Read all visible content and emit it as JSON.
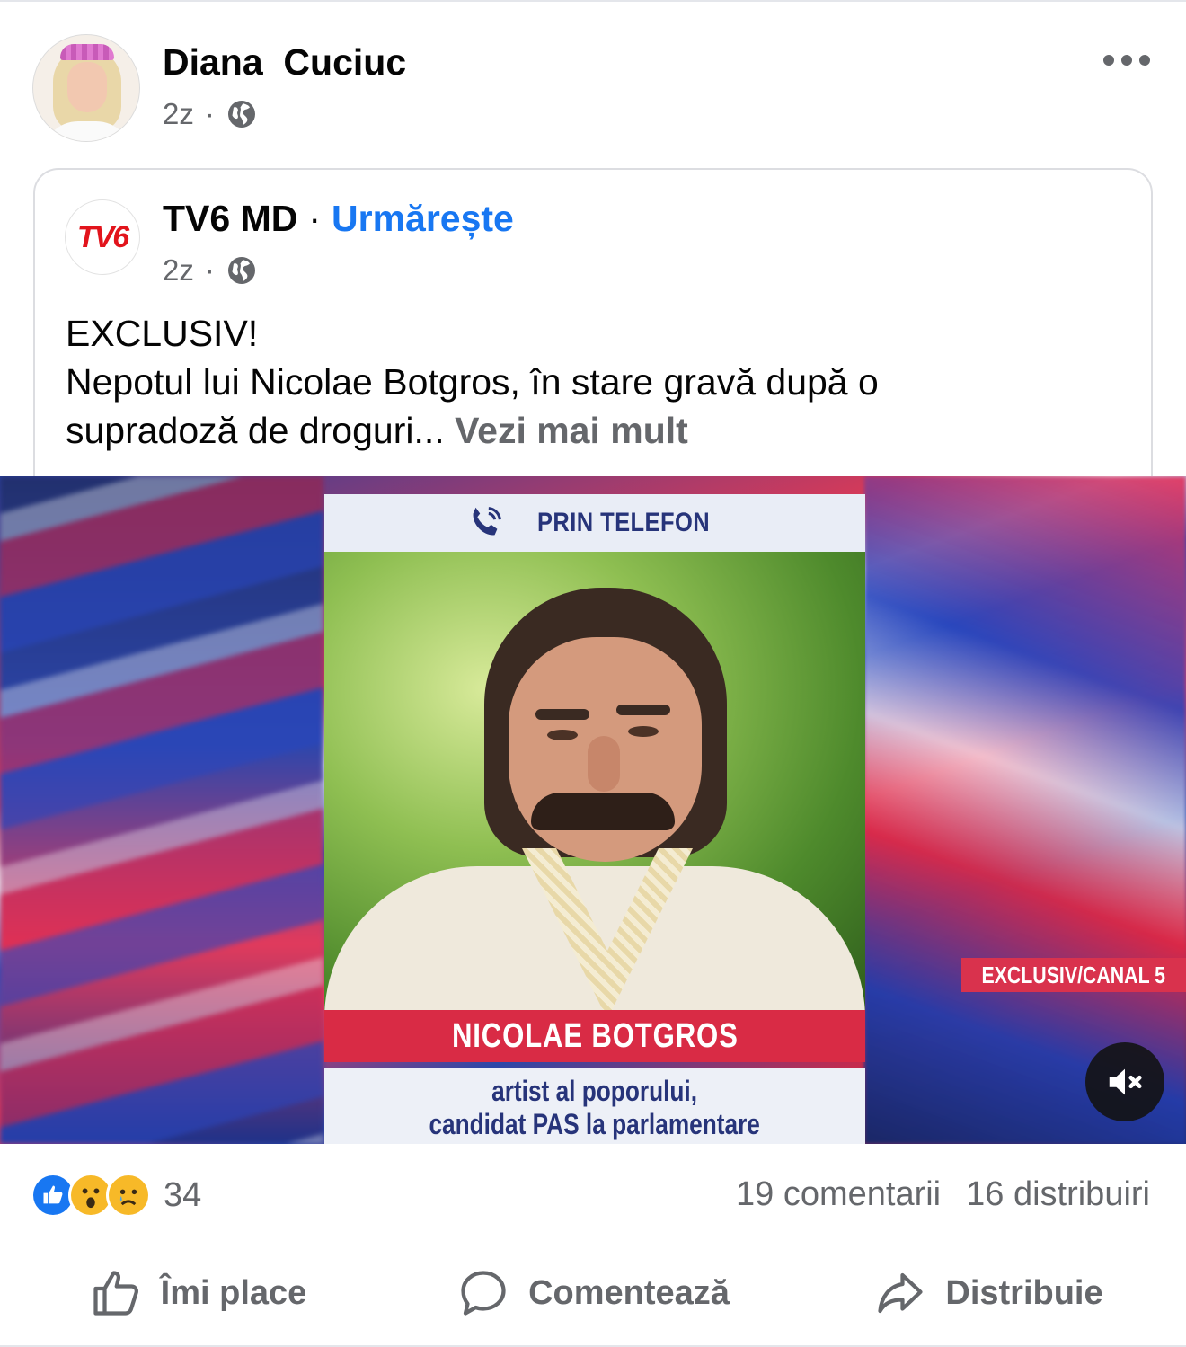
{
  "post": {
    "author": "Diana  Cuciuc",
    "time": "2z",
    "separator": "·",
    "privacy_icon": "globe-icon",
    "more_icon": "more-options-icon"
  },
  "shared": {
    "page_name": "TV6 MD",
    "separator": "·",
    "follow_label": "Urmărește",
    "time": "2z",
    "logo_text": "TV6",
    "text_line1": "EXCLUSIV!",
    "text_line2": "Nepotul lui Nicolae Botgros, în stare gravă după o",
    "text_line3": "supradoză de droguri...",
    "see_more": "Vezi mai mult"
  },
  "media": {
    "phone_label": "PRIN TELEFON",
    "name_caption": "NICOLAE BOTGROS",
    "desc_line1": "artist al poporului,",
    "desc_line2": "candidat PAS la parlamentare",
    "tag": "EXCLUSIV/CANAL 5",
    "mute_icon": "speaker-muted-icon"
  },
  "stats": {
    "reactions": [
      "like",
      "wow",
      "sad"
    ],
    "reaction_count": "34",
    "comments": "19 comentarii",
    "shares": "16 distribuiri"
  },
  "actions": {
    "like": "Îmi place",
    "comment": "Comentează",
    "share": "Distribuie"
  },
  "colors": {
    "accent": "#1877f2",
    "secondary_text": "#65676b",
    "caption_red": "#d92b45",
    "caption_navy": "#27347a"
  }
}
